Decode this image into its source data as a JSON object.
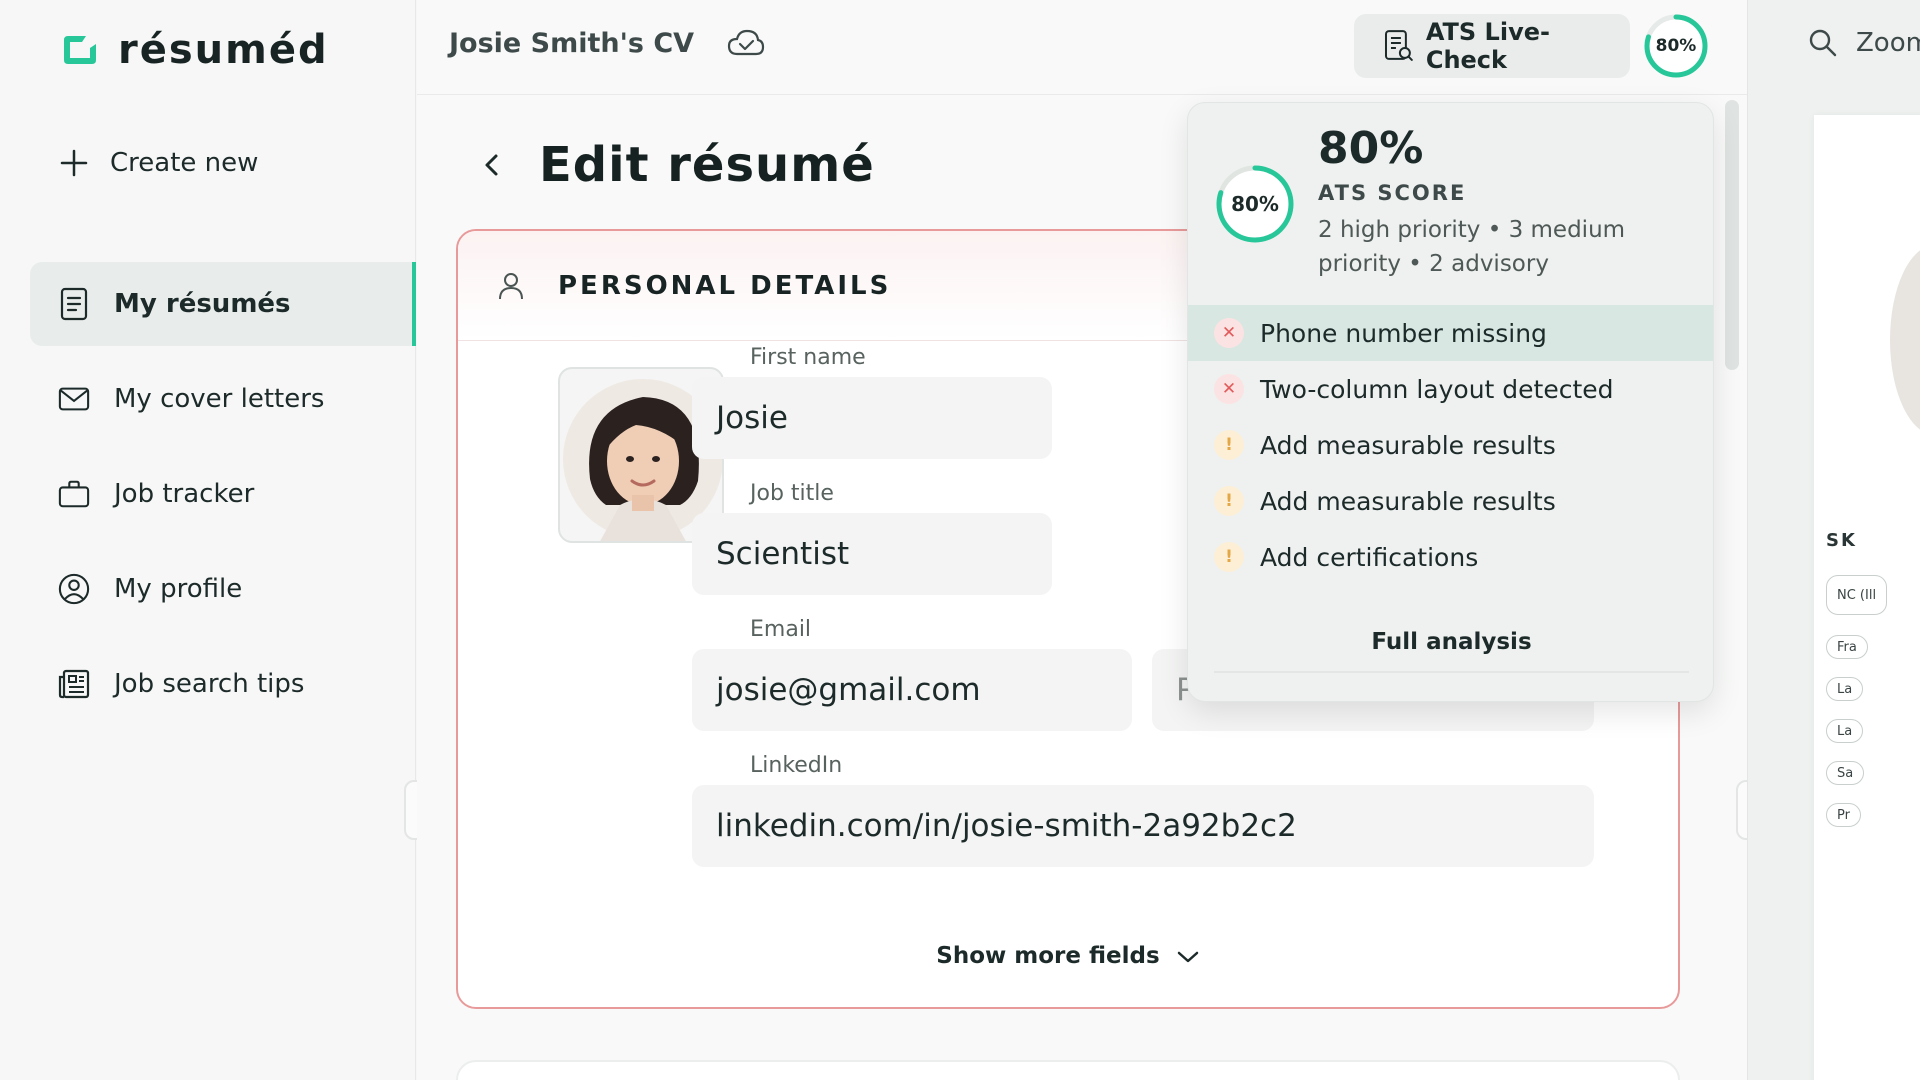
{
  "brand": {
    "name": "résuméd",
    "accent": "#27c79a"
  },
  "sidebar": {
    "create_new": "Create new",
    "items": [
      {
        "label": "My résumés",
        "icon": "document-icon",
        "active": true
      },
      {
        "label": "My cover letters",
        "icon": "mail-icon",
        "active": false
      },
      {
        "label": "Job tracker",
        "icon": "briefcase-icon",
        "active": false
      },
      {
        "label": "My profile",
        "icon": "user-circle-icon",
        "active": false
      },
      {
        "label": "Job search tips",
        "icon": "newspaper-icon",
        "active": false
      }
    ]
  },
  "topbar": {
    "cv_title": "Josie Smith's CV",
    "ats_button": "ATS Live-Check",
    "ats_ring_label": "80%",
    "ats_score_fraction": 0.8
  },
  "main": {
    "page_title": "Edit résumé",
    "section_title": "PERSONAL DETAILS",
    "fields": {
      "first_name_label": "First name",
      "first_name_value": "Josie",
      "job_title_label": "Job title",
      "job_title_value": "Scientist",
      "email_label": "Email",
      "email_value": "josie@gmail.com",
      "phone_placeholder": "Phone",
      "linkedin_label": "LinkedIn",
      "linkedin_value": "linkedin.com/in/josie-smith-2a92b2c2"
    },
    "show_more": "Show more fields"
  },
  "preview": {
    "zoom_label": "Zoom",
    "skills_heading": "SK",
    "pills": [
      "NC (Ill",
      "Fra",
      "La",
      "La",
      "Sa",
      "Pr"
    ]
  },
  "ats_popover": {
    "score": "80%",
    "ring_label": "80%",
    "label": "ATS SCORE",
    "summary": "2 high priority • 3 medium priority • 2 advisory",
    "issues": [
      {
        "text": "Phone number missing",
        "severity": "high",
        "symbol": "✕",
        "active": true
      },
      {
        "text": "Two-column layout detected",
        "severity": "high",
        "symbol": "✕",
        "active": false
      },
      {
        "text": "Add measurable results",
        "severity": "medium",
        "symbol": "!",
        "active": false
      },
      {
        "text": "Add measurable results",
        "severity": "medium",
        "symbol": "!",
        "active": false
      },
      {
        "text": "Add certifications",
        "severity": "medium",
        "symbol": "!",
        "active": false
      }
    ],
    "full_analysis": "Full analysis",
    "colors": {
      "high": "#e25a5a",
      "medium": "#e3a845",
      "ring": "#27c79a"
    }
  }
}
